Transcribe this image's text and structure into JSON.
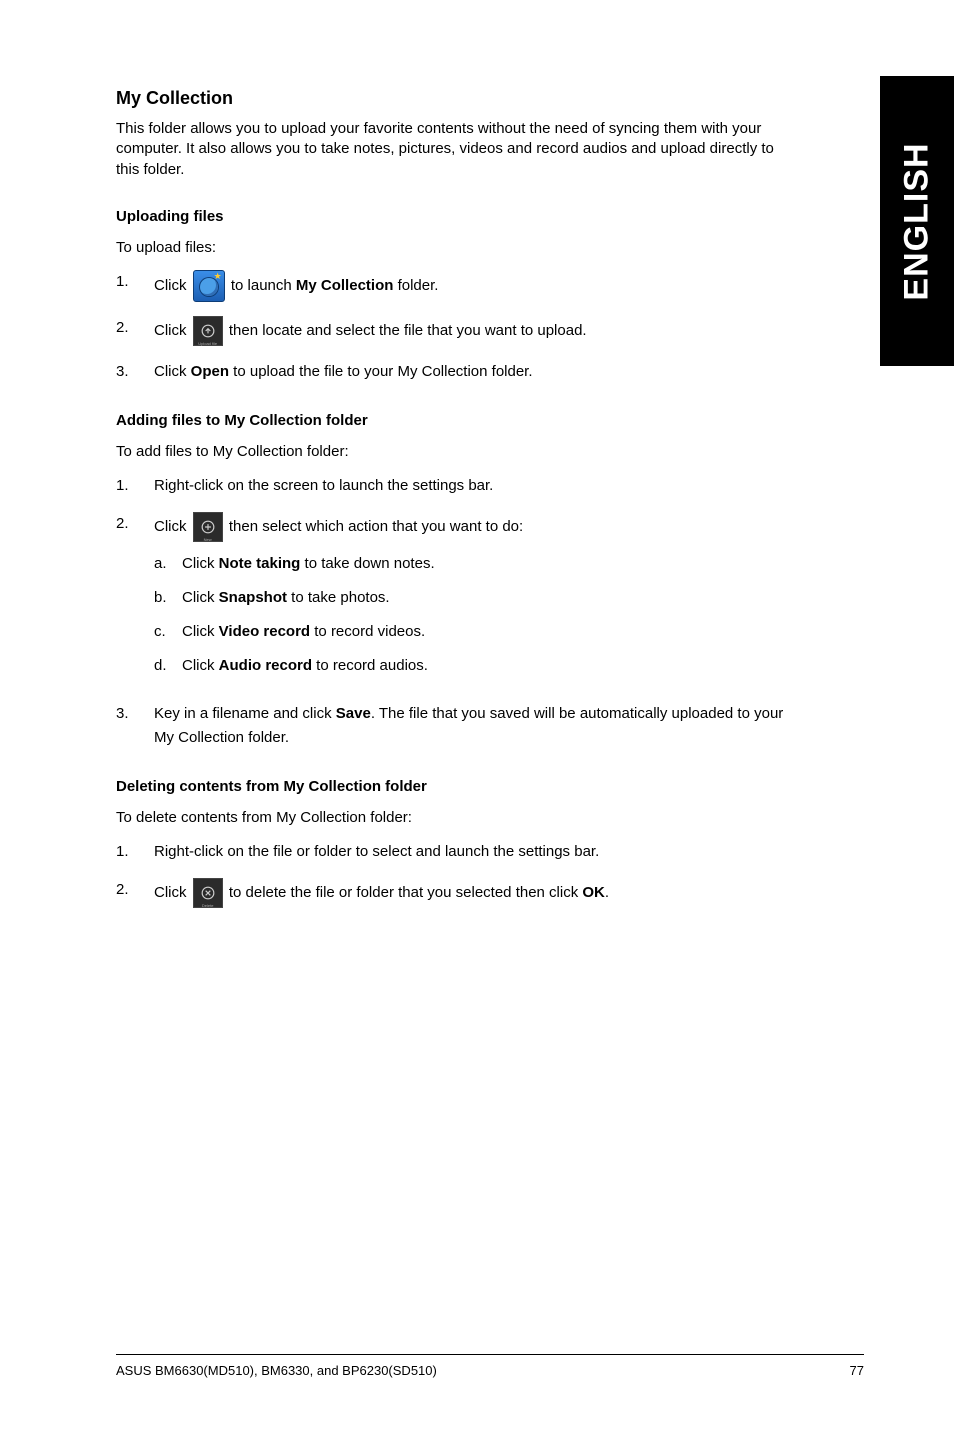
{
  "side_tab": "ENGLISH",
  "title": "My Collection",
  "intro": "This folder allows you to upload your favorite contents without the need of syncing them with your computer. It also allows you to take notes, pictures, videos and record audios and upload directly to this folder.",
  "upload": {
    "heading": "Uploading files",
    "lead": "To upload files:",
    "step1_a": "Click ",
    "step1_b": " to launch ",
    "step1_bold": "My Collection",
    "step1_c": " folder.",
    "step2_a": "Click ",
    "step2_b": " then locate and select the file that you want to upload.",
    "step3_a": "Click ",
    "step3_bold": "Open",
    "step3_b": " to upload the file to your My Collection folder."
  },
  "add": {
    "heading": "Adding files to My Collection folder",
    "lead": "To add files to My Collection folder:",
    "step1": "Right-click on the screen to launch the settings bar.",
    "step2_a": "Click ",
    "step2_b": " then select which action that you want to do:",
    "sub_a_a": "Click ",
    "sub_a_bold": "Note taking",
    "sub_a_b": " to take down notes.",
    "sub_b_a": "Click ",
    "sub_b_bold": "Snapshot",
    "sub_b_b": " to take photos.",
    "sub_c_a": "Click ",
    "sub_c_bold": "Video record",
    "sub_c_b": " to record videos.",
    "sub_d_a": "Click ",
    "sub_d_bold": "Audio record",
    "sub_d_b": " to record audios.",
    "step3_a": "Key in a filename and click ",
    "step3_bold": "Save",
    "step3_b": ". The file that you saved will be automatically uploaded to your My Collection folder."
  },
  "del": {
    "heading": "Deleting contents from My Collection folder",
    "lead": "To delete contents from My Collection folder:",
    "step1": "Right-click on the file or folder to select and launch the settings bar.",
    "step2_a": "Click ",
    "step2_b": " to delete the file or folder that you selected then click ",
    "step2_bold": "OK",
    "step2_c": "."
  },
  "icons": {
    "upload_label": "Upload file",
    "new_label": "New",
    "delete_label": "Delete"
  },
  "footer": {
    "left": "ASUS BM6630(MD510), BM6330, and BP6230(SD510)",
    "right": "77"
  }
}
